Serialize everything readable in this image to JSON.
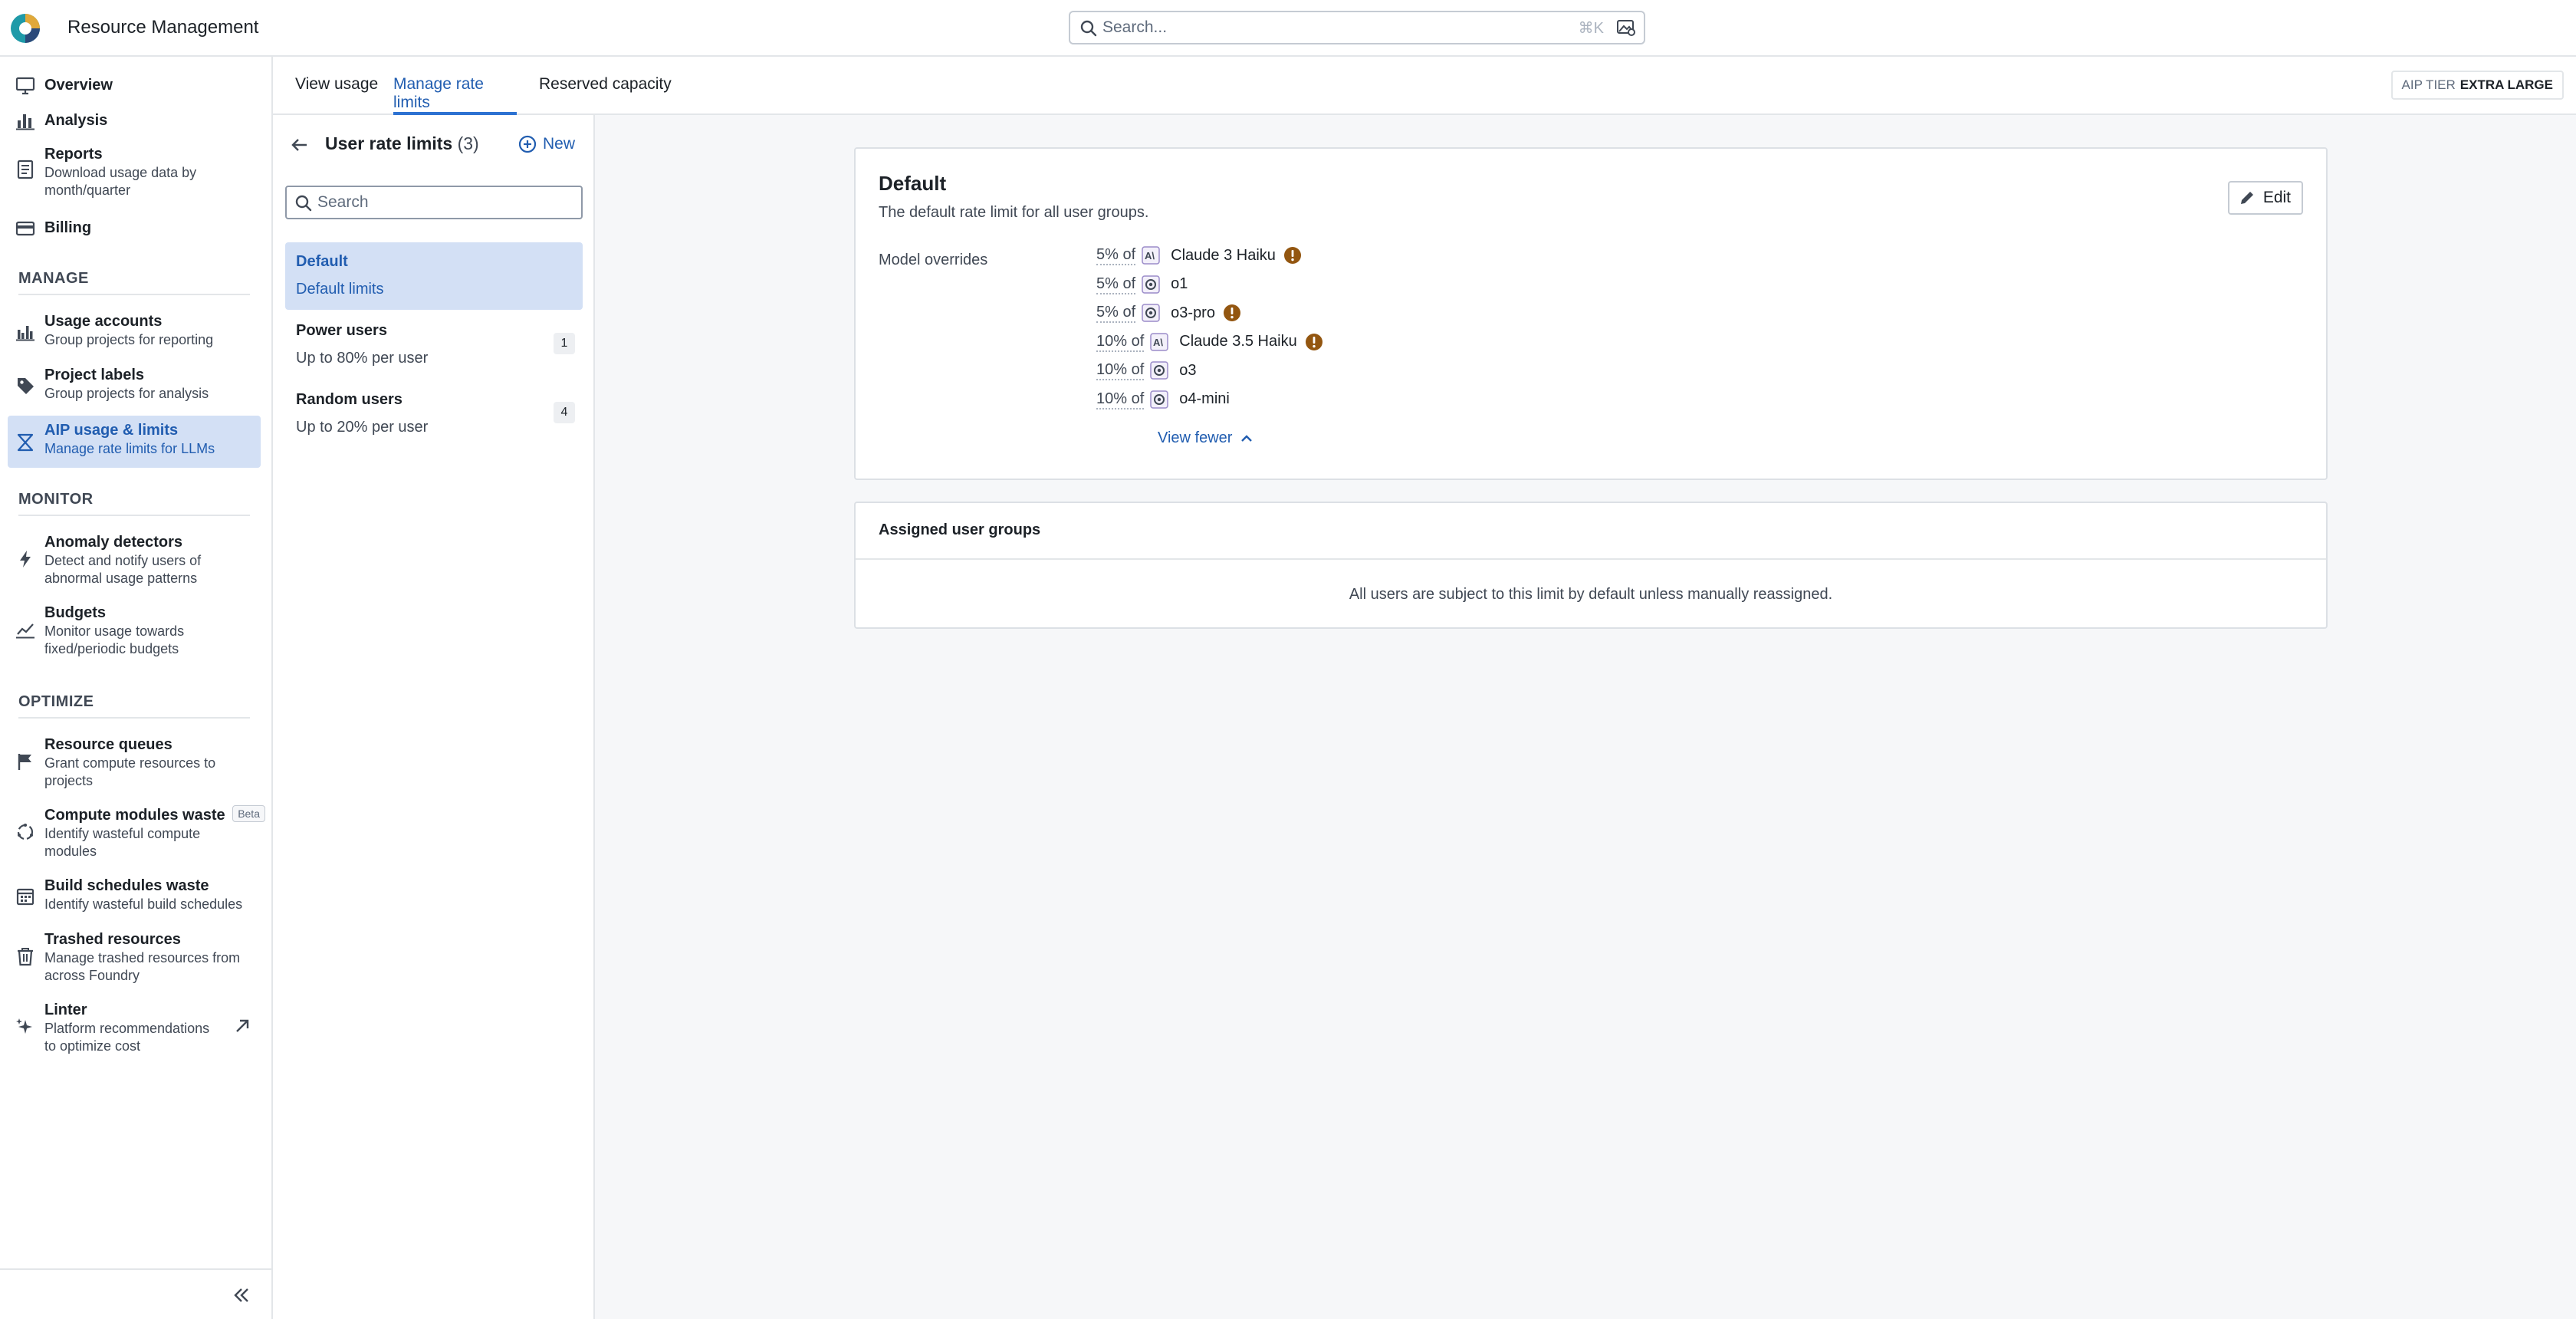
{
  "app": {
    "title": "Resource Management",
    "search_placeholder": "Search...",
    "search_shortcut": "⌘K",
    "icon": "app-logo"
  },
  "sidebar": {
    "items": [
      {
        "title": "Overview",
        "icon": "monitor-icon"
      },
      {
        "title": "Analysis",
        "icon": "bar-chart-icon"
      },
      {
        "title": "Reports",
        "subtitle": "Download usage data by month/quarter",
        "icon": "document-icon"
      },
      {
        "title": "Billing",
        "icon": "credit-card-icon"
      }
    ],
    "manage_label": "MANAGE",
    "manage_items": [
      {
        "title": "Usage accounts",
        "subtitle": "Group projects for reporting",
        "icon": "grouped-bars-icon"
      },
      {
        "title": "Project labels",
        "subtitle": "Group projects for analysis",
        "icon": "tag-icon"
      },
      {
        "title": "AIP usage & limits",
        "subtitle": "Manage rate limits for LLMs",
        "icon": "hourglass-icon",
        "active": true
      }
    ],
    "monitor_label": "MONITOR",
    "monitor_items": [
      {
        "title": "Anomaly detectors",
        "subtitle": "Detect and notify users of abnormal usage patterns",
        "icon": "lightning-icon"
      },
      {
        "title": "Budgets",
        "subtitle": "Monitor usage towards fixed/periodic budgets",
        "icon": "line-chart-icon"
      }
    ],
    "optimize_label": "OPTIMIZE",
    "optimize_items": [
      {
        "title": "Resource queues",
        "subtitle": "Grant compute resources to projects",
        "icon": "flag-icon"
      },
      {
        "title": "Compute modules waste",
        "subtitle": "Identify wasteful compute modules",
        "icon": "cycle-icon",
        "badge": "Beta"
      },
      {
        "title": "Build schedules waste",
        "subtitle": "Identify wasteful build schedules",
        "icon": "calendar-icon"
      },
      {
        "title": "Trashed resources",
        "subtitle": "Manage trashed resources from across Foundry",
        "icon": "trash-icon"
      },
      {
        "title": "Linter",
        "subtitle": "Platform recommendations to optimize cost",
        "icon": "sparkle-icon"
      }
    ]
  },
  "tabs": {
    "items": [
      "View usage",
      "Manage rate limits",
      "Reserved capacity"
    ],
    "active": "Manage rate limits",
    "tier_label": "AIP TIER",
    "tier_value": "EXTRA LARGE"
  },
  "list": {
    "title": "User rate limits",
    "count": "(3)",
    "new_label": "New",
    "search_placeholder": "Search",
    "items": [
      {
        "title": "Default",
        "subtitle": "Default limits",
        "selected": true
      },
      {
        "title": "Power users",
        "subtitle": "Up to 80% per user",
        "count": "1"
      },
      {
        "title": "Random users",
        "subtitle": "Up to 20% per user",
        "count": "4"
      }
    ]
  },
  "detail": {
    "title": "Default",
    "description": "The default rate limit for all user groups.",
    "edit_label": "Edit",
    "overrides_label": "Model overrides",
    "overrides": [
      {
        "percent": "5% of",
        "model": "Claude 3 Haiku",
        "provider_icon": "anthropic-icon",
        "warning": true
      },
      {
        "percent": "5% of",
        "model": "o1",
        "provider_icon": "openai-icon",
        "warning": false
      },
      {
        "percent": "5% of",
        "model": "o3-pro",
        "provider_icon": "openai-icon",
        "warning": true
      },
      {
        "percent": "10% of",
        "model": "Claude 3.5 Haiku",
        "provider_icon": "anthropic-icon",
        "warning": true
      },
      {
        "percent": "10% of",
        "model": "o3",
        "provider_icon": "openai-icon",
        "warning": false
      },
      {
        "percent": "10% of",
        "model": "o4-mini",
        "provider_icon": "openai-icon",
        "warning": false
      }
    ],
    "view_fewer_label": "View fewer",
    "groups_title": "Assigned user groups",
    "groups_empty": "All users are subject to this limit by default unless manually reassigned."
  },
  "colors": {
    "accent": "#2d72d2",
    "accent_text": "#215db0",
    "active_bg": "#d3e0f5",
    "warning": "#935610",
    "border": "#e3e6e9"
  }
}
